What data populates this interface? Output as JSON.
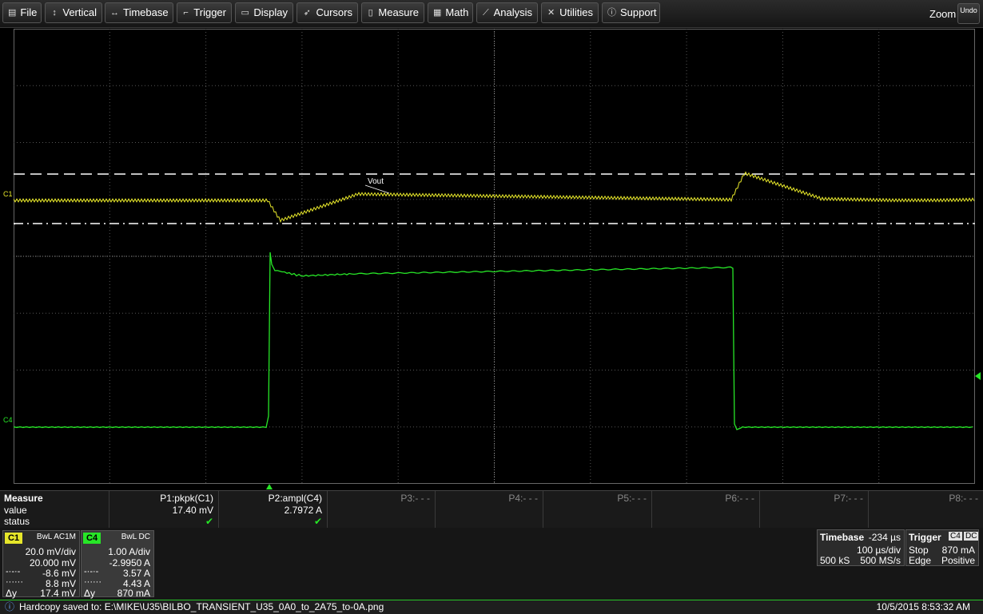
{
  "menu": {
    "items": [
      {
        "label": "File",
        "icon": "folder-icon"
      },
      {
        "label": "Vertical",
        "icon": "vertical-arrows-icon"
      },
      {
        "label": "Timebase",
        "icon": "horizontal-arrows-icon"
      },
      {
        "label": "Trigger",
        "icon": "trigger-icon"
      },
      {
        "label": "Display",
        "icon": "display-icon"
      },
      {
        "label": "Cursors",
        "icon": "cursor-icon"
      },
      {
        "label": "Measure",
        "icon": "ruler-icon"
      },
      {
        "label": "Math",
        "icon": "calculator-icon"
      },
      {
        "label": "Analysis",
        "icon": "chart-icon"
      },
      {
        "label": "Utilities",
        "icon": "tools-icon"
      },
      {
        "label": "Support",
        "icon": "info-icon"
      }
    ],
    "zoom_label": "Zoom",
    "undo_label": "Undo"
  },
  "waveform": {
    "trace_label": "Vout",
    "c1_marker": "C1",
    "c4_marker": "C4",
    "c1_color": "#e6e62a",
    "c4_color": "#27e627"
  },
  "measure": {
    "title": "Measure",
    "row_value": "value",
    "row_status": "status",
    "params": [
      {
        "name": "P1:pkpk(C1)",
        "value": "17.40 mV",
        "status": "✔"
      },
      {
        "name": "P2:ampl(C4)",
        "value": "2.7972 A",
        "status": "✔"
      },
      {
        "name": "P3:- - -",
        "value": "",
        "status": ""
      },
      {
        "name": "P4:- - -",
        "value": "",
        "status": ""
      },
      {
        "name": "P5:- - -",
        "value": "",
        "status": ""
      },
      {
        "name": "P6:- - -",
        "value": "",
        "status": ""
      },
      {
        "name": "P7:- - -",
        "value": "",
        "status": ""
      },
      {
        "name": "P8:- - -",
        "value": "",
        "status": ""
      }
    ]
  },
  "channels": {
    "c1": {
      "tag": "C1",
      "mode": "BwL AC1M",
      "scale": "20.0 mV/div",
      "offset": "20.000 mV",
      "cursor1": "-8.6 mV",
      "cursor2": "8.8 mV",
      "delta_label": "Δy",
      "delta": "17.4 mV",
      "color": "#e6e62a"
    },
    "c4": {
      "tag": "C4",
      "mode": "BwL DC",
      "scale": "1.00 A/div",
      "offset": "-2.9950 A",
      "cursor1": "3.57 A",
      "cursor2": "4.43 A",
      "delta_label": "Δy",
      "delta": "870 mA",
      "color": "#27e627"
    }
  },
  "timebase": {
    "title": "Timebase",
    "delay": "-234 µs",
    "per_div": "100 µs/div",
    "samples": "500 kS",
    "rate": "500 MS/s"
  },
  "trigger": {
    "title": "Trigger",
    "source": "C4",
    "coupling": "DC",
    "mode": "Stop",
    "level": "870 mA",
    "type": "Edge",
    "slope": "Positive"
  },
  "status": {
    "message": "Hardcopy saved to: E:\\MIKE\\U35\\BILBO_TRANSIENT_U35_0A0_to_2A75_to-0A.png",
    "timestamp": "10/5/2015 8:53:32 AM"
  }
}
